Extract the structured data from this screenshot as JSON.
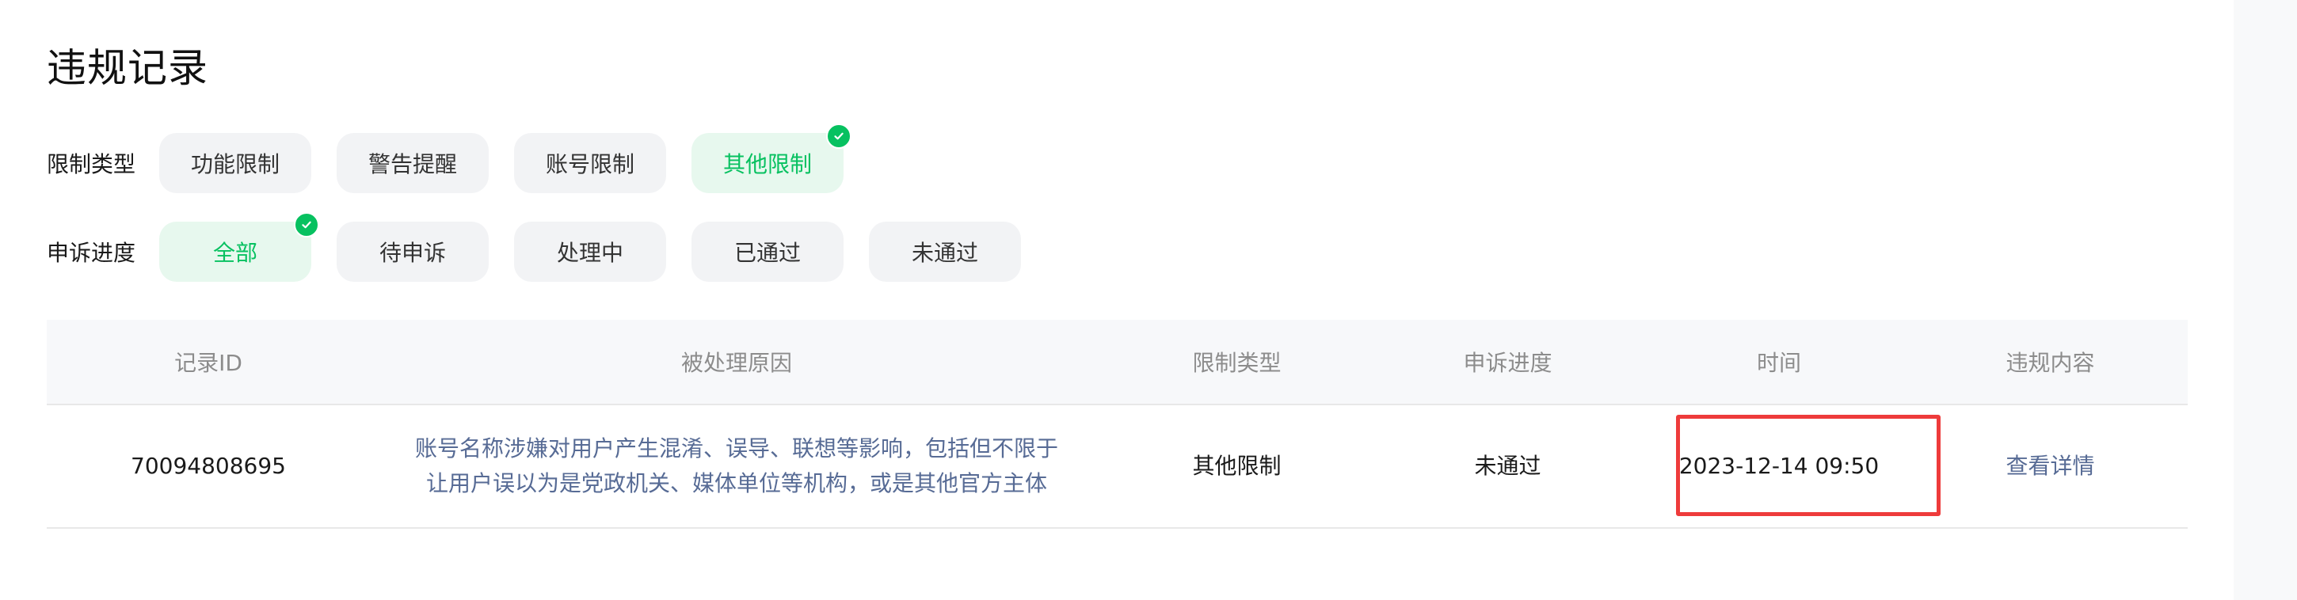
{
  "page": {
    "title": "违规记录"
  },
  "filters": {
    "type": {
      "label": "限制类型",
      "options": [
        "功能限制",
        "警告提醒",
        "账号限制",
        "其他限制"
      ],
      "selected": "其他限制"
    },
    "appeal": {
      "label": "申诉进度",
      "options": [
        "全部",
        "待申诉",
        "处理中",
        "已通过",
        "未通过"
      ],
      "selected": "全部"
    }
  },
  "table": {
    "headers": [
      "记录ID",
      "被处理原因",
      "限制类型",
      "申诉进度",
      "时间",
      "违规内容"
    ],
    "rows": [
      {
        "id": "70094808695",
        "reason_line1": "账号名称涉嫌对用户产生混淆、误导、联想等影响，包括但不限于",
        "reason_line2": "让用户误以为是党政机关、媒体单位等机构，或是其他官方主体",
        "type": "其他限制",
        "appeal": "未通过",
        "time": "2023-12-14 09:50",
        "action": "查看详情"
      }
    ]
  },
  "colors": {
    "accent_green": "#07c160",
    "selected_bg": "#e7f8ee",
    "link_blue": "#576b95",
    "highlight_red": "#ee3b3b"
  },
  "icons": {
    "selected_marker": "check-circle-icon"
  }
}
